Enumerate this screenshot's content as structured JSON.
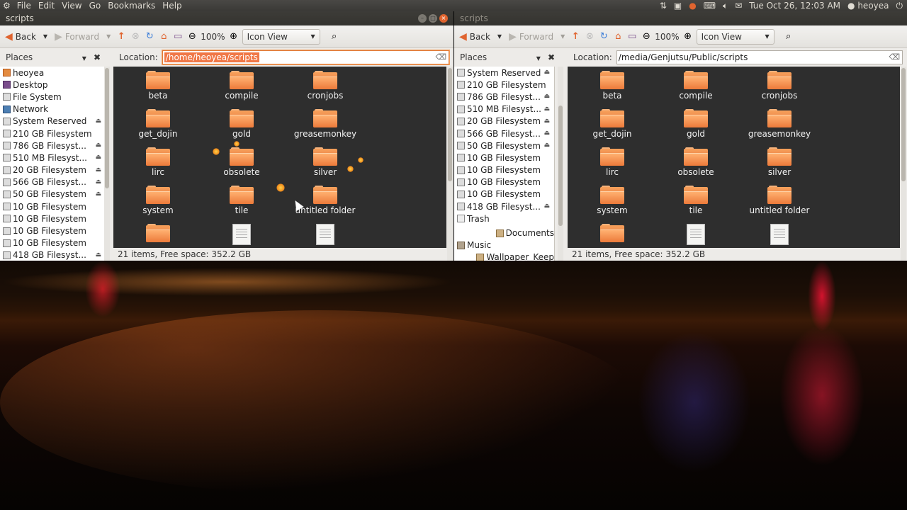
{
  "top_panel": {
    "menus": [
      "File",
      "Edit",
      "View",
      "Go",
      "Bookmarks",
      "Help"
    ],
    "clock": "Tue Oct 26, 12:03 AM",
    "user": "heoyea"
  },
  "left_window": {
    "title": "scripts",
    "toolbar": {
      "back": "Back",
      "forward": "Forward",
      "zoom": "100%",
      "view": "Icon View"
    },
    "places_header": "Places",
    "location_label": "Location:",
    "location_value": "/home/heoyea/scripts",
    "places": [
      {
        "label": "heoyea",
        "icon": "home"
      },
      {
        "label": "Desktop",
        "icon": "desk"
      },
      {
        "label": "File System",
        "icon": "drive"
      },
      {
        "label": "Network",
        "icon": "net"
      },
      {
        "label": "System Reserved",
        "icon": "drive",
        "eject": true
      },
      {
        "label": "210 GB Filesystem",
        "icon": "drive"
      },
      {
        "label": "786 GB Filesyst...",
        "icon": "drive",
        "eject": true
      },
      {
        "label": "510 MB Filesyst...",
        "icon": "drive",
        "eject": true
      },
      {
        "label": "20 GB Filesystem",
        "icon": "drive",
        "eject": true
      },
      {
        "label": "566 GB Filesyst...",
        "icon": "drive",
        "eject": true
      },
      {
        "label": "50 GB Filesystem",
        "icon": "drive",
        "eject": true
      },
      {
        "label": "10 GB Filesystem",
        "icon": "drive"
      },
      {
        "label": "10 GB Filesystem",
        "icon": "drive"
      },
      {
        "label": "10 GB Filesystem",
        "icon": "drive"
      },
      {
        "label": "10 GB Filesystem",
        "icon": "drive"
      },
      {
        "label": "418 GB Filesyst...",
        "icon": "drive",
        "eject": true
      }
    ],
    "files": [
      "beta",
      "compile",
      "cronjobs",
      "get_dojin",
      "gold",
      "greasemonkey",
      "lirc",
      "obsolete",
      "silver",
      "system",
      "tile",
      "untitled folder"
    ],
    "status": "21 items, Free space: 352.2 GB"
  },
  "right_window": {
    "title": "scripts",
    "toolbar": {
      "back": "Back",
      "forward": "Forward",
      "zoom": "100%",
      "view": "Icon View"
    },
    "places_header": "Places",
    "location_label": "Location:",
    "location_value": "/media/Genjutsu/Public/scripts",
    "places": [
      {
        "label": "System Reserved",
        "icon": "drive",
        "eject": true
      },
      {
        "label": "210 GB Filesystem",
        "icon": "drive"
      },
      {
        "label": "786 GB Filesyst...",
        "icon": "drive",
        "eject": true
      },
      {
        "label": "510 MB Filesyst...",
        "icon": "drive",
        "eject": true
      },
      {
        "label": "20 GB Filesystem",
        "icon": "drive",
        "eject": true
      },
      {
        "label": "566 GB Filesyst...",
        "icon": "drive",
        "eject": true
      },
      {
        "label": "50 GB Filesystem",
        "icon": "drive",
        "eject": true
      },
      {
        "label": "10 GB Filesystem",
        "icon": "drive"
      },
      {
        "label": "10 GB Filesystem",
        "icon": "drive"
      },
      {
        "label": "10 GB Filesystem",
        "icon": "drive"
      },
      {
        "label": "10 GB Filesystem",
        "icon": "drive"
      },
      {
        "label": "418 GB Filesyst...",
        "icon": "drive",
        "eject": true
      },
      {
        "label": "Trash",
        "icon": "trash"
      },
      {
        "label": "Documents",
        "icon": "doc",
        "gap": true
      },
      {
        "label": "Music",
        "icon": "music"
      },
      {
        "label": "Wallpaper_Keep",
        "icon": "doc"
      }
    ],
    "files": [
      "beta",
      "compile",
      "cronjobs",
      "get_dojin",
      "gold",
      "greasemonkey",
      "lirc",
      "obsolete",
      "silver",
      "system",
      "tile",
      "untitled folder"
    ],
    "status": "21 items, Free space: 352.2 GB"
  },
  "colors": {
    "accent": "#e0642f",
    "panel": "#3c3b37",
    "content_bg": "#2e2e2e"
  }
}
